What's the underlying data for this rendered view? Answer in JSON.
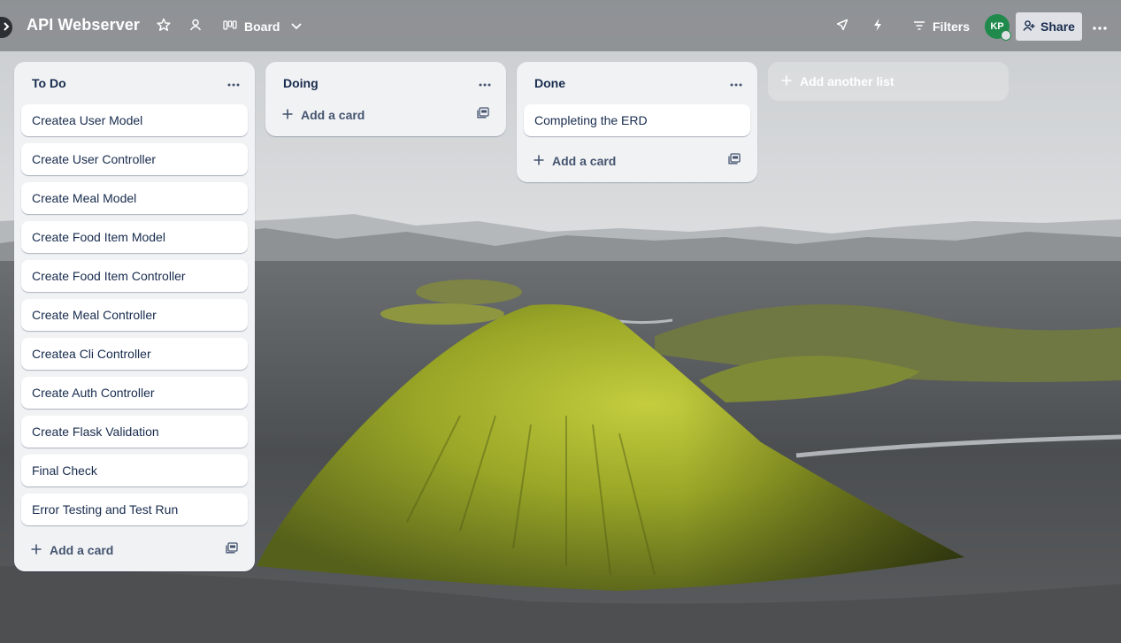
{
  "board": {
    "title": "API Webserver",
    "view_label": "Board",
    "filters_label": "Filters",
    "share_label": "Share",
    "avatar_initials": "KP"
  },
  "lists": [
    {
      "title": "To Do",
      "cards": [
        "Createa User Model",
        "Create User Controller",
        "Create Meal Model",
        "Create Food Item Model",
        "Create Food Item Controller",
        "Create Meal Controller",
        "Createa Cli Controller",
        "Create Auth Controller",
        "Create Flask Validation",
        "Final Check",
        "Error Testing and Test Run"
      ],
      "add_card_label": "Add a card"
    },
    {
      "title": "Doing",
      "cards": [],
      "add_card_label": "Add a card"
    },
    {
      "title": "Done",
      "cards": [
        "Completing the ERD"
      ],
      "add_card_label": "Add a card"
    }
  ],
  "add_list_label": "Add another list",
  "icons": {
    "expand": "chevron-right-icon",
    "star": "star-icon",
    "workspace_visibility": "people-icon",
    "board_view": "board-view-icon",
    "view_dropdown": "chevron-down-icon",
    "power_ups": "rocket-icon",
    "automation": "lightning-icon",
    "filters": "filter-icon",
    "share": "add-person-icon",
    "more": "ellipsis-icon",
    "list_menu": "ellipsis-icon",
    "add": "plus-icon",
    "template": "card-template-icon"
  },
  "colors": {
    "avatar": "#1f8a4c",
    "list_bg": "#f1f2f4",
    "card_bg": "#ffffff",
    "text": "#172b4d"
  }
}
